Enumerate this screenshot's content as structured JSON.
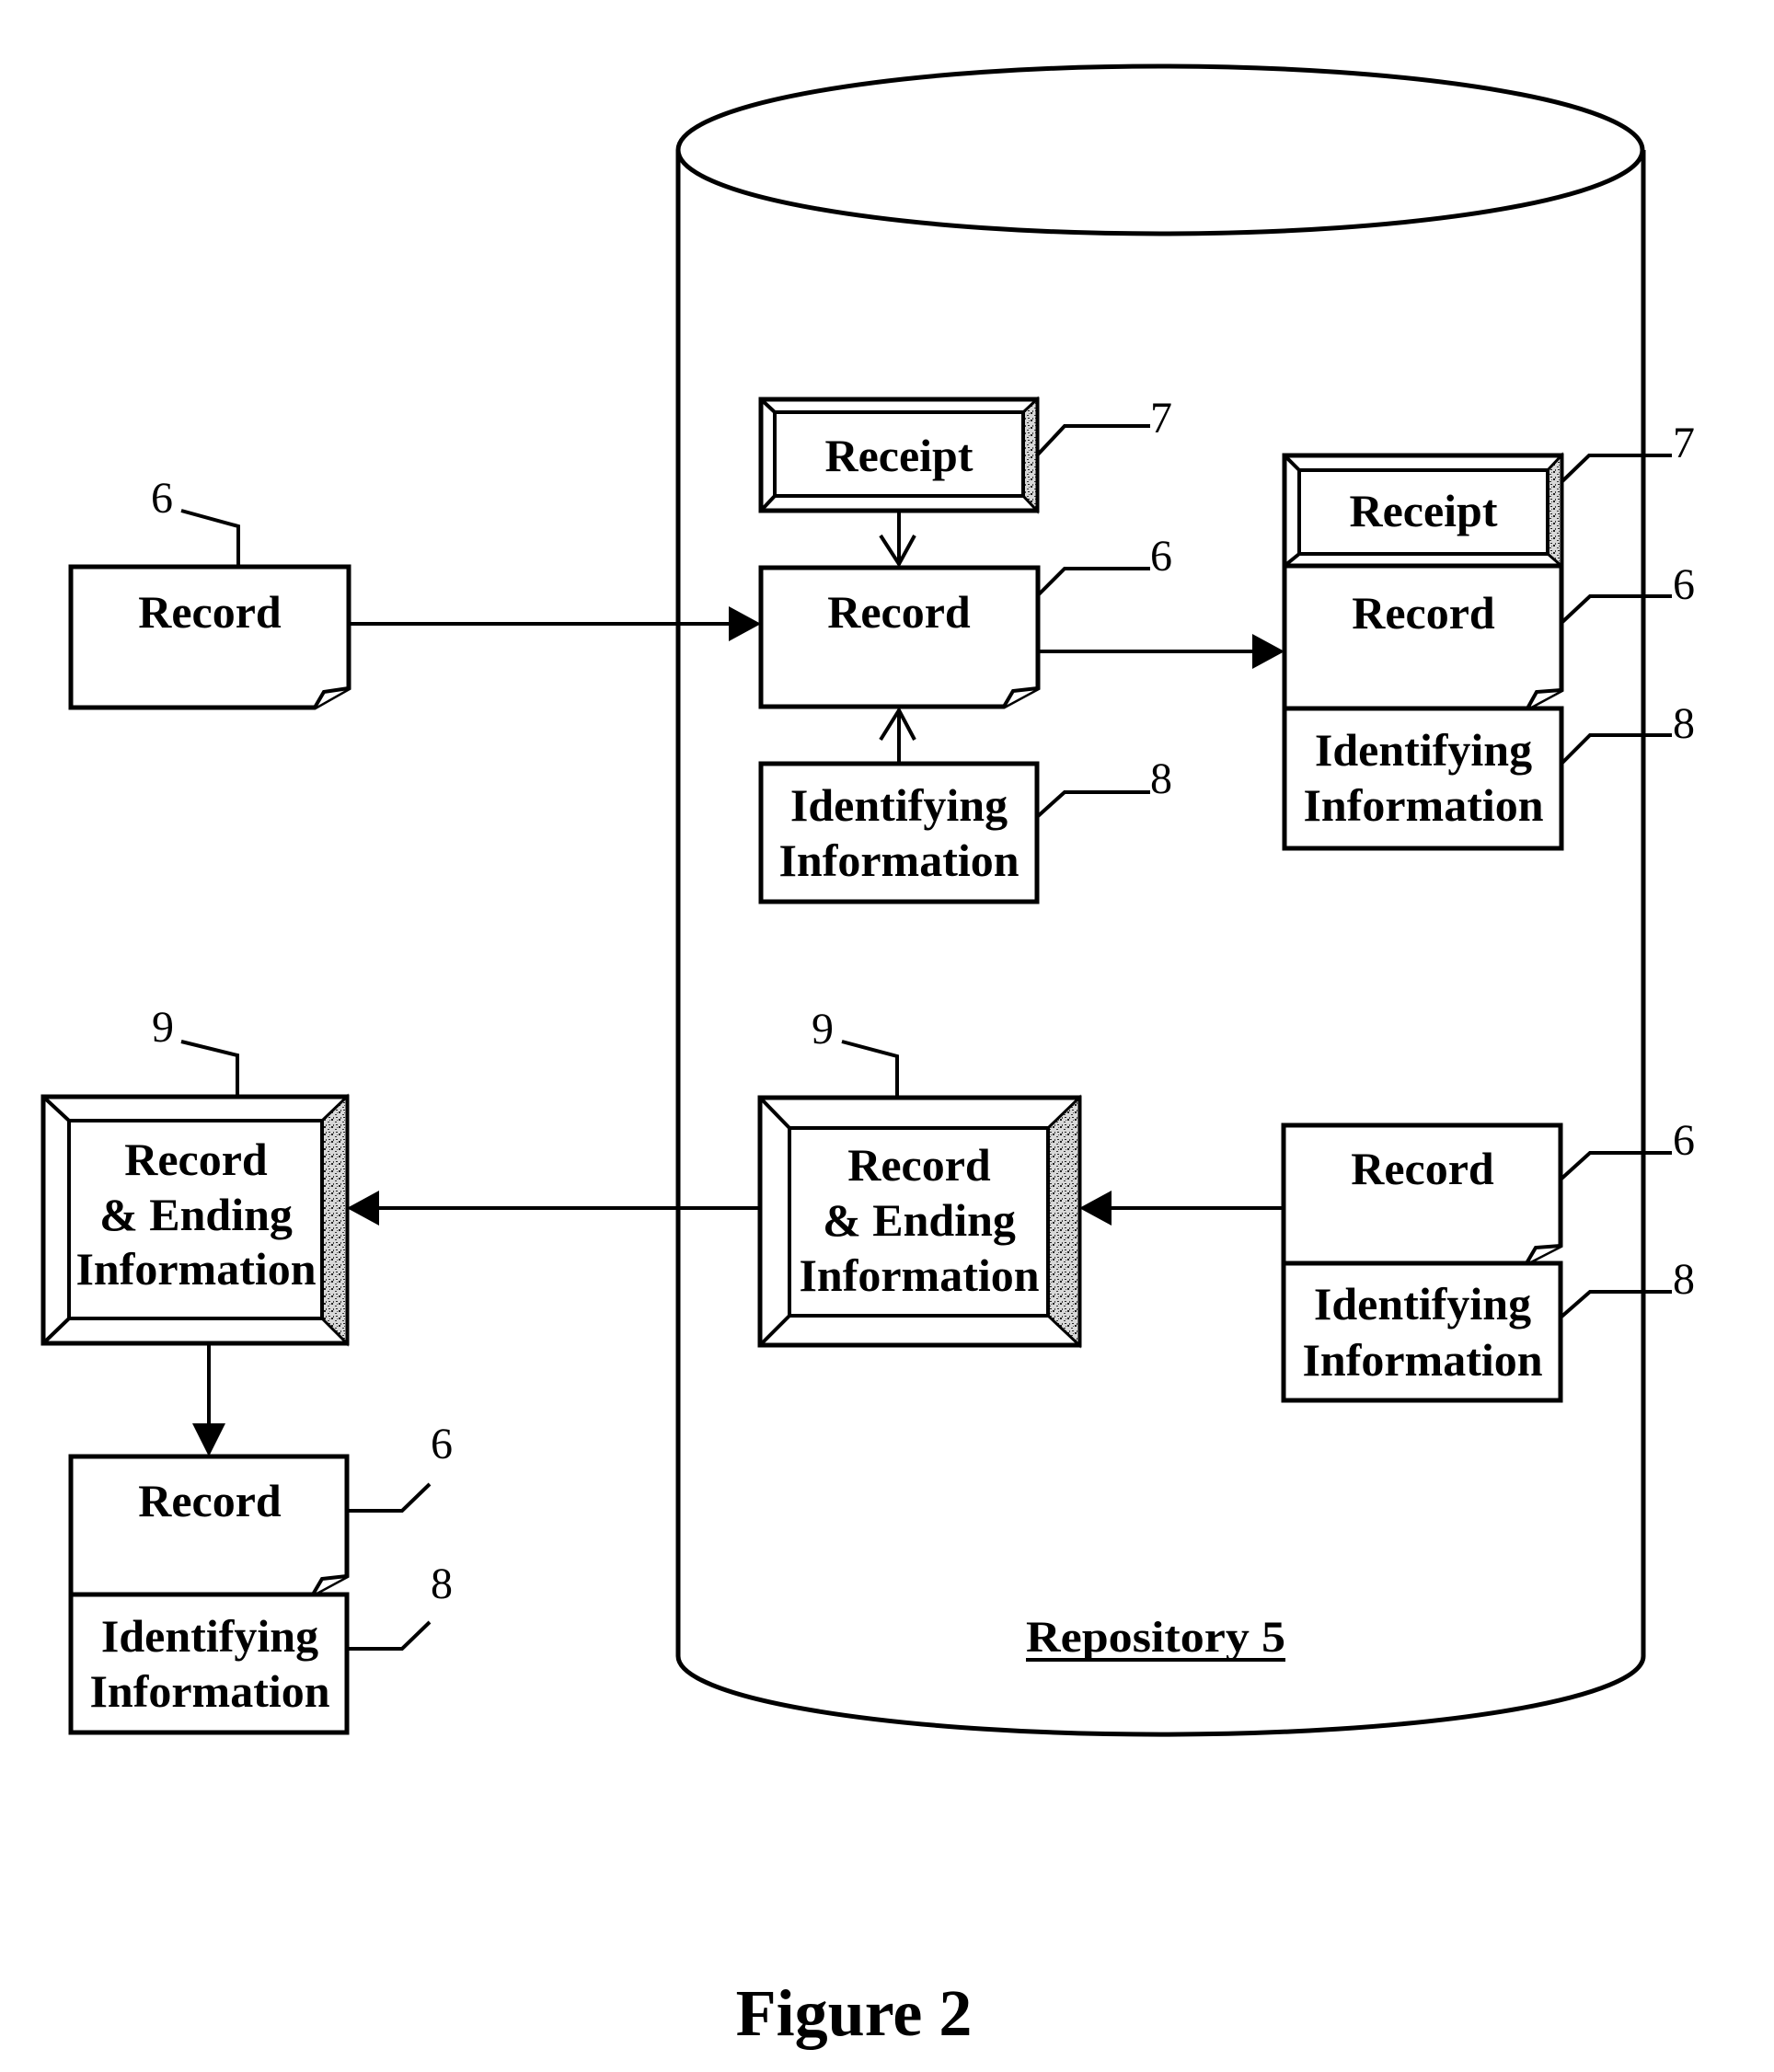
{
  "figure": {
    "caption": "Figure 2",
    "colors": {
      "ink": "#000000",
      "background": "#ffffff",
      "bevel_texture": "#9a9a9a"
    }
  },
  "repository": {
    "label": "Repository  5",
    "ref": "5"
  },
  "nodes": {
    "input_record": {
      "label": "Record",
      "ref": "6"
    },
    "center_receipt": {
      "label": "Receipt",
      "ref": "7"
    },
    "center_record": {
      "label": "Record",
      "ref": "6"
    },
    "center_identifying": {
      "line1": "Identifying",
      "line2": "Information",
      "ref": "8"
    },
    "stack_receipt": {
      "label": "Receipt",
      "ref": "7"
    },
    "stack_record": {
      "label": "Record",
      "ref": "6"
    },
    "stack_identifying": {
      "line1": "Identifying",
      "line2": "Information",
      "ref": "8"
    },
    "lower_record": {
      "label": "Record",
      "ref": "6"
    },
    "lower_identifying": {
      "line1": "Identifying",
      "line2": "Information",
      "ref": "8"
    },
    "ending_inner": {
      "line1": "Record",
      "line2": "& Ending",
      "line3": "Information",
      "ref": "9"
    },
    "ending_outer": {
      "line1": "Record",
      "line2": "& Ending",
      "line3": "Information",
      "ref": "9"
    },
    "output_record": {
      "label": "Record",
      "ref": "6"
    },
    "output_identifying": {
      "line1": "Identifying",
      "line2": "Information",
      "ref": "8"
    }
  },
  "edges": [
    {
      "from": "input_record",
      "to": "center_record",
      "head": "filled"
    },
    {
      "from": "center_receipt",
      "to": "center_record",
      "head": "open"
    },
    {
      "from": "center_identifying",
      "to": "center_record",
      "head": "open"
    },
    {
      "from": "center_record",
      "to": "stack_record",
      "head": "filled"
    },
    {
      "from": "lower_record",
      "to": "ending_inner",
      "head": "filled"
    },
    {
      "from": "ending_inner",
      "to": "ending_outer",
      "head": "filled"
    },
    {
      "from": "ending_outer",
      "to": "output_record",
      "head": "filled"
    }
  ]
}
